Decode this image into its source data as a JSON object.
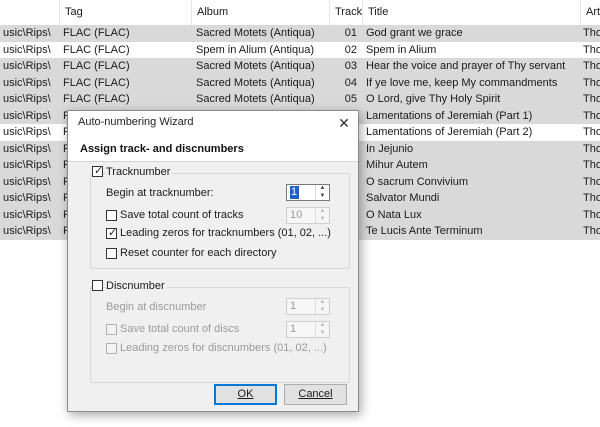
{
  "columns": {
    "tag": "Tag",
    "album": "Album",
    "track": "Track",
    "title": "Title",
    "artist": "Arti"
  },
  "rows": [
    {
      "path": "usic\\Rips\\",
      "tag": "FLAC (FLAC)",
      "album": "Sacred Motets (Antiqua)",
      "track": "01",
      "title": "God grant we grace",
      "artist": "Tho",
      "shade": "grey"
    },
    {
      "path": "usic\\Rips\\",
      "tag": "FLAC (FLAC)",
      "album": "Spem in Alium (Antiqua)",
      "track": "02",
      "title": "Spem in Alium",
      "artist": "Tho",
      "shade": "white"
    },
    {
      "path": "usic\\Rips\\",
      "tag": "FLAC (FLAC)",
      "album": "Sacred Motets (Antiqua)",
      "track": "03",
      "title": "Hear the voice and prayer of Thy servant",
      "artist": "Tho",
      "shade": "grey"
    },
    {
      "path": "usic\\Rips\\",
      "tag": "FLAC (FLAC)",
      "album": "Sacred Motets (Antiqua)",
      "track": "04",
      "title": "If ye love me, keep My commandments",
      "artist": "Tho",
      "shade": "grey"
    },
    {
      "path": "usic\\Rips\\",
      "tag": "FLAC (FLAC)",
      "album": "Sacred Motets (Antiqua)",
      "track": "05",
      "title": "O Lord, give Thy Holy Spirit",
      "artist": "Tho",
      "shade": "grey"
    },
    {
      "path": "usic\\Rips\\",
      "tag": "FL",
      "album": "",
      "track": "",
      "title": "Lamentations of Jeremiah (Part 1)",
      "artist": "Tho",
      "shade": "grey"
    },
    {
      "path": "usic\\Rips\\",
      "tag": "FL",
      "album": "",
      "track": "",
      "title": "Lamentations of Jeremiah (Part 2)",
      "artist": "Tho",
      "shade": "white"
    },
    {
      "path": "usic\\Rips\\",
      "tag": "FL",
      "album": "",
      "track": "",
      "title": "In Jejunio",
      "artist": "Tho",
      "shade": "grey"
    },
    {
      "path": "usic\\Rips\\",
      "tag": "FL",
      "album": "",
      "track": "",
      "title": "Mihur Autem",
      "artist": "Tho",
      "shade": "grey"
    },
    {
      "path": "usic\\Rips\\",
      "tag": "FL",
      "album": "",
      "track": "",
      "title": "O sacrum Convivium",
      "artist": "Tho",
      "shade": "grey"
    },
    {
      "path": "usic\\Rips\\",
      "tag": "FL",
      "album": "",
      "track": "",
      "title": "Salvator Mundi",
      "artist": "Tho",
      "shade": "grey"
    },
    {
      "path": "usic\\Rips\\",
      "tag": "FL",
      "album": "",
      "track": "",
      "title": "O Nata Lux",
      "artist": "Tho",
      "shade": "grey"
    },
    {
      "path": "usic\\Rips\\",
      "tag": "FL",
      "album": "",
      "track": "",
      "title": "Te Lucis Ante Terminum",
      "artist": "Tho",
      "shade": "grey"
    }
  ],
  "dialog": {
    "title": "Auto-numbering Wizard",
    "close_glyph": "✕",
    "heading": "Assign track- and discnumbers",
    "tracknumber": {
      "label": "Tracknumber",
      "checked": true,
      "begin_label": "Begin at tracknumber:",
      "begin_value": "1",
      "save_total_label": "Save total count of tracks",
      "save_total_checked": false,
      "save_total_value": "10",
      "leading_zeros_label": "Leading zeros for tracknumbers (01, 02, ...)",
      "leading_zeros_checked": true,
      "reset_label": "Reset counter for each directory",
      "reset_checked": false
    },
    "discnumber": {
      "label": "Discnumber",
      "checked": false,
      "begin_label": "Begin at discnumber",
      "begin_value": "1",
      "save_total_label": "Save total count of discs",
      "save_total_value": "1",
      "leading_zeros_label": "Leading zeros for discnumbers (01, 02, ...)"
    },
    "ok_label": "OK",
    "cancel_label": "Cancel",
    "check_glyph": "✓",
    "spin_up_glyph": "▲",
    "spin_down_glyph": "▼"
  }
}
